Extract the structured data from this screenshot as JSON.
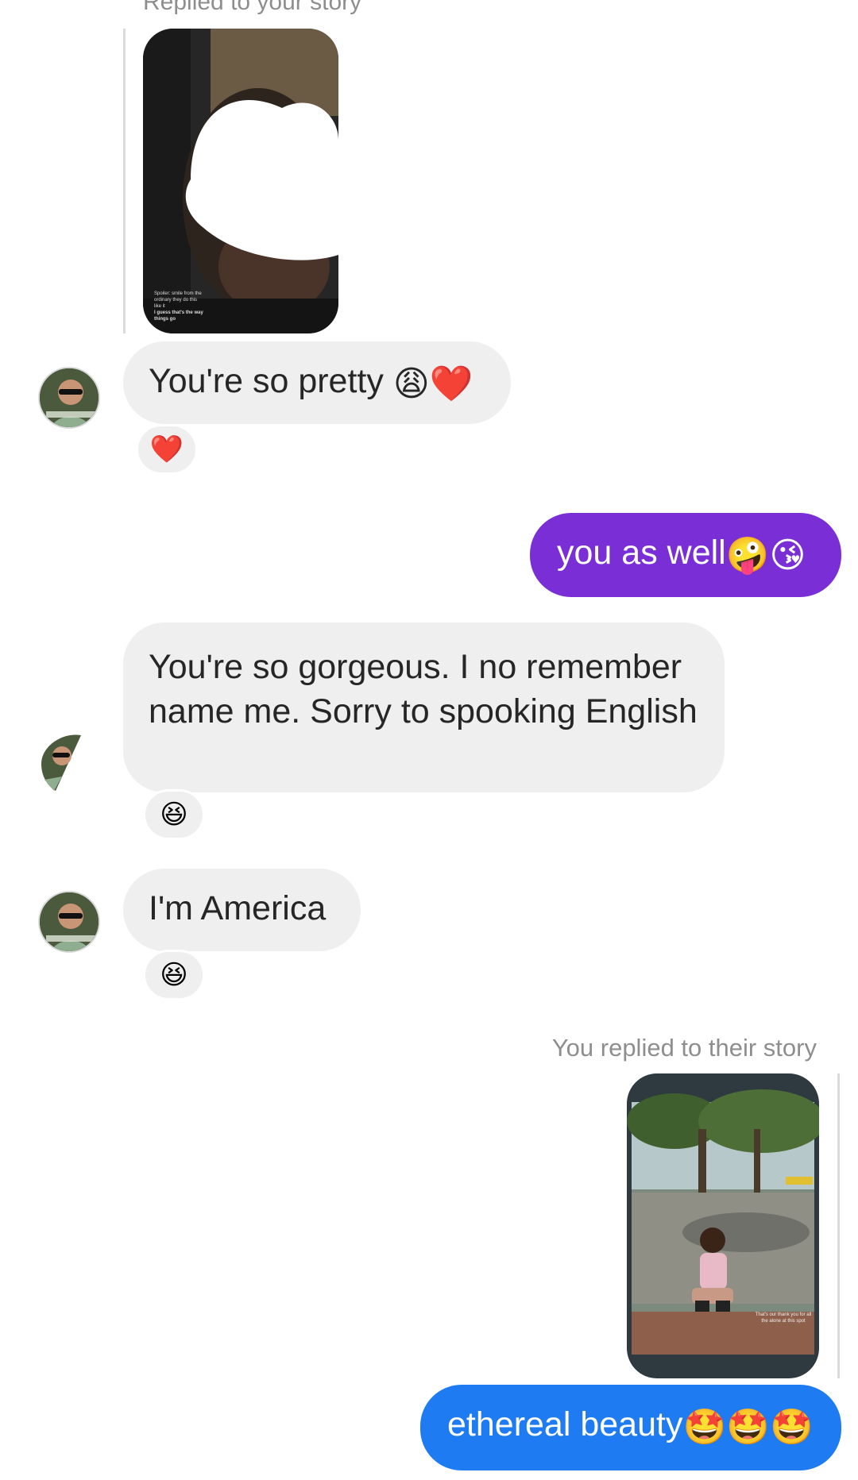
{
  "thread": {
    "top_meta": "Replied to your story",
    "story_in_caption": [
      "Spoiler: smile from the",
      "ordinary they do this",
      "like it",
      "I guess that's the way",
      "things go"
    ],
    "messages": [
      {
        "text": "You're so pretty",
        "emoji": "😩❤️",
        "reaction": "❤️"
      },
      {
        "text": "you as well",
        "emoji": "🤪😘"
      },
      {
        "text": "You're so gorgeous. I no remember name me. Sorry to spooking English",
        "reaction": "😆"
      },
      {
        "text": "I'm America",
        "reaction": "😆"
      },
      {
        "meta": "You replied to their story"
      },
      {
        "text": "ethereal beauty",
        "emoji": "🤩🤩🤩"
      }
    ],
    "story_out_caption": "That's our thank you for all the alone at this spot",
    "colors": {
      "outgoing_purple": "#7a2fd6",
      "outgoing_blue": "#1f7bf2",
      "incoming_bg": "#efefef"
    }
  }
}
